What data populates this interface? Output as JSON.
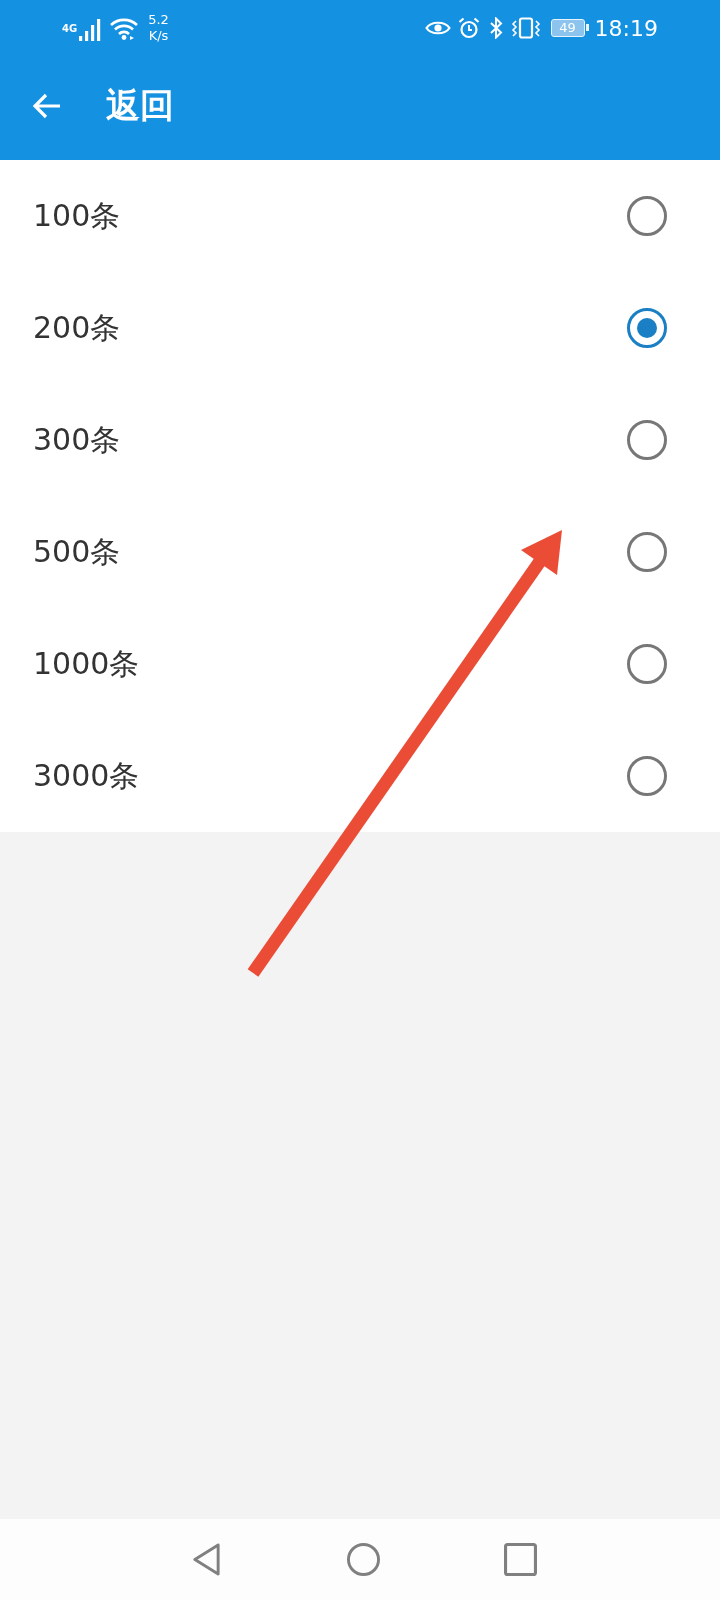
{
  "status_bar": {
    "network": "4G",
    "speed": "5.2",
    "speed_unit": "K/s",
    "battery": "49",
    "time": "18:19"
  },
  "header": {
    "title": "返回"
  },
  "options": [
    {
      "label": "100条",
      "selected": false
    },
    {
      "label": "200条",
      "selected": true
    },
    {
      "label": "300条",
      "selected": false
    },
    {
      "label": "500条",
      "selected": false
    },
    {
      "label": "1000条",
      "selected": false
    },
    {
      "label": "3000条",
      "selected": false
    }
  ]
}
